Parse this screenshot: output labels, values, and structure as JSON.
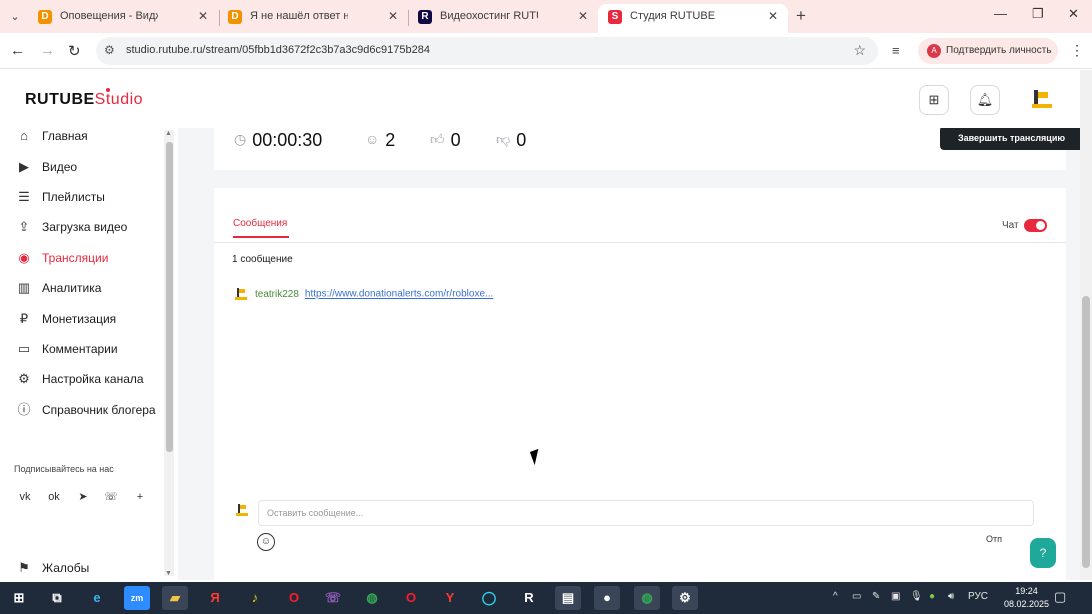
{
  "browser": {
    "tabs": [
      {
        "title": "Оповещения - Виджеты - Пан",
        "favicon": "D",
        "favicon_color": "#f39200"
      },
      {
        "title": "Я не нашёл ответ на свой воп",
        "favicon": "D",
        "favicon_color": "#f39200"
      },
      {
        "title": "Видеохостинг RUTUBE. Смотр",
        "favicon": "R",
        "favicon_color": "#100943"
      },
      {
        "title": "Студия RUTUBE",
        "favicon": "S",
        "favicon_color": "#e8283d"
      }
    ],
    "active_tab": 3,
    "url": "studio.rutube.ru/stream/05fbb1d3672f2c3b7a3c9d6c9175b284",
    "verify_label": "Подтвердить личность"
  },
  "studio": {
    "logo_main": "RUTUBE",
    "logo_suffix": "Studio",
    "accent_color": "#e8283d"
  },
  "sidebar": {
    "items": [
      {
        "label": "Главная",
        "icon": "home-icon"
      },
      {
        "label": "Видео",
        "icon": "video-icon"
      },
      {
        "label": "Плейлисты",
        "icon": "playlist-icon"
      },
      {
        "label": "Загрузка видео",
        "icon": "upload-icon"
      },
      {
        "label": "Трансляции",
        "icon": "broadcast-icon",
        "active": true
      },
      {
        "label": "Аналитика",
        "icon": "analytics-icon"
      },
      {
        "label": "Монетизация",
        "icon": "monetization-icon"
      },
      {
        "label": "Комментарии",
        "icon": "comments-icon"
      },
      {
        "label": "Настройка канала",
        "icon": "settings-icon"
      },
      {
        "label": "Справочник блогера",
        "icon": "help-icon"
      }
    ],
    "follow_label": "Подписывайтесь на нас",
    "socials": [
      "vk-icon",
      "ok-icon",
      "telegram-icon",
      "viber-icon",
      "plus-icon"
    ],
    "complaints_label": "Жалобы"
  },
  "stream": {
    "duration": "00:00:30",
    "viewers": "2",
    "likes": "0",
    "dislikes": "0",
    "end_button": "Завершить трансляцию"
  },
  "chat": {
    "tab_label": "Сообщения",
    "toggle_label": "Чат",
    "toggle_on": true,
    "count_label": "1 сообщение",
    "messages": [
      {
        "author": "teatrik228",
        "text": "https://www.donationalerts.com/r/robloxe..."
      }
    ],
    "input_placeholder": "Оставить сообщение...",
    "send_label": "Отп"
  },
  "taskbar": {
    "lang": "РУС",
    "time": "19:24",
    "date": "08.02.2025"
  }
}
